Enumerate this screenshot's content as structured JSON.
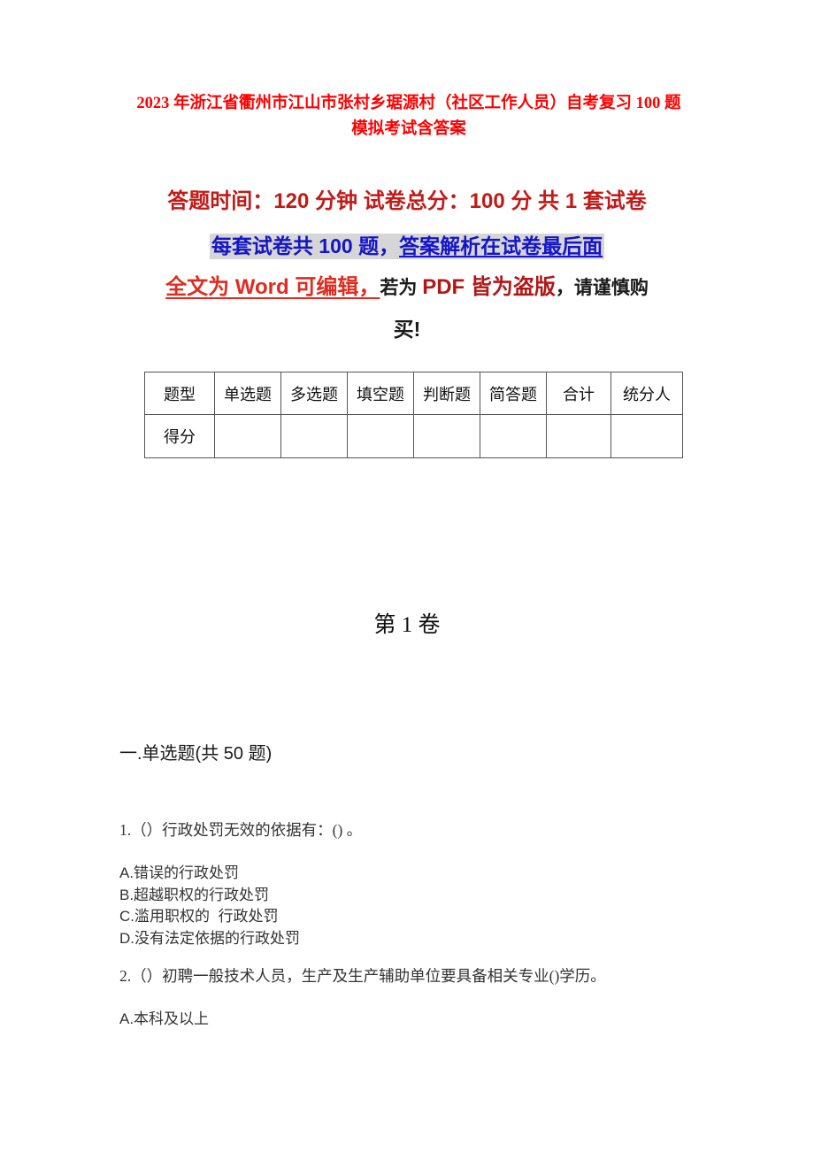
{
  "document": {
    "title": "2023 年浙江省衢州市江山市张村乡琚源村（社区工作人员）自考复习 100 题模拟考试含答案",
    "colors": {
      "title_red": "#FF0000",
      "subtitle_red": "#C21A17",
      "highlight_blue": "#1414C8",
      "highlight_bg": "#D6D6D6",
      "word_red": "#E02B20",
      "pdf_crimson": "#B01818",
      "body_text": "#333333",
      "table_border": "#555555"
    }
  },
  "header": {
    "exam_info_line": "答题时间：120 分钟    试卷总分：100 分    共 1 套试卷",
    "highlight_line": {
      "plain": "每套试卷共 100 题，",
      "underlined": "答案解析在试卷最后面"
    },
    "notice_line": {
      "part1_red_underlined": "全文为 Word 可编辑，",
      "part2_black": "若为 ",
      "part3_crimson": "PDF 皆为盗版",
      "part4_black": "，请谨慎购",
      "part5_black_next_line": "买!"
    }
  },
  "score_table": {
    "headers": [
      "题型",
      "单选题",
      "多选题",
      "填空题",
      "判断题",
      "简答题",
      "合计",
      "统分人"
    ],
    "rows": [
      {
        "label": "得分",
        "cells": [
          "",
          "",
          "",
          "",
          "",
          "",
          ""
        ]
      }
    ]
  },
  "volume": {
    "heading": "第 1 卷"
  },
  "sections": [
    {
      "heading": "一.单选题(共 50 题)",
      "questions": [
        {
          "stem": "1.（）行政处罚无效的依据有：() 。",
          "options": [
            "A.错误的行政处罚",
            "B.超越职权的行政处罚",
            "C.滥用职权的  行政处罚",
            "D.没有法定依据的行政处罚"
          ]
        },
        {
          "stem": "2.（）初聘一般技术人员，生产及生产辅助单位要具备相关专业()学历。",
          "options": [
            "A.本科及以上"
          ]
        }
      ]
    }
  ]
}
